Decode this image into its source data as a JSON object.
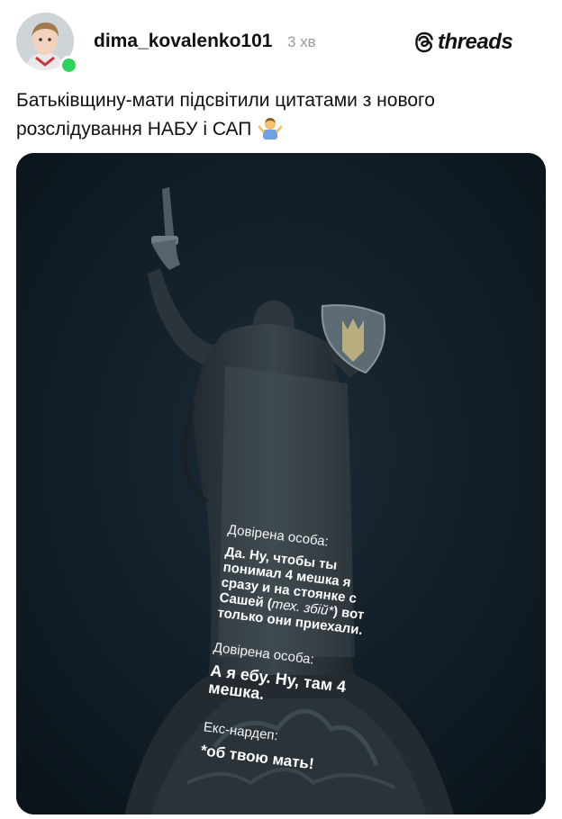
{
  "post": {
    "username": "dima_kovalenko101",
    "time": "3 хв",
    "brand": "threads",
    "text": "Батьківщину-мати підсвітили цитатами з нового розслідування НАБУ і САП",
    "emoji_icon": "person-shrugging-emoji",
    "online_color": "#2bd45b"
  },
  "image": {
    "speaker1": "Довірена особа:",
    "quote1_part1": "Да. Ну, чтобы ты понимал 4 мешка я сразу и на стоянке с Сашей (",
    "quote1_italic": "тех. збій*",
    "quote1_part2": ") вот только они приехали.",
    "speaker2": "Довірена особа:",
    "quote2": "А я ебу. Ну, там 4 мешка.",
    "speaker3": "Екс-нардеп:",
    "quote3": "*об твою мать!"
  }
}
